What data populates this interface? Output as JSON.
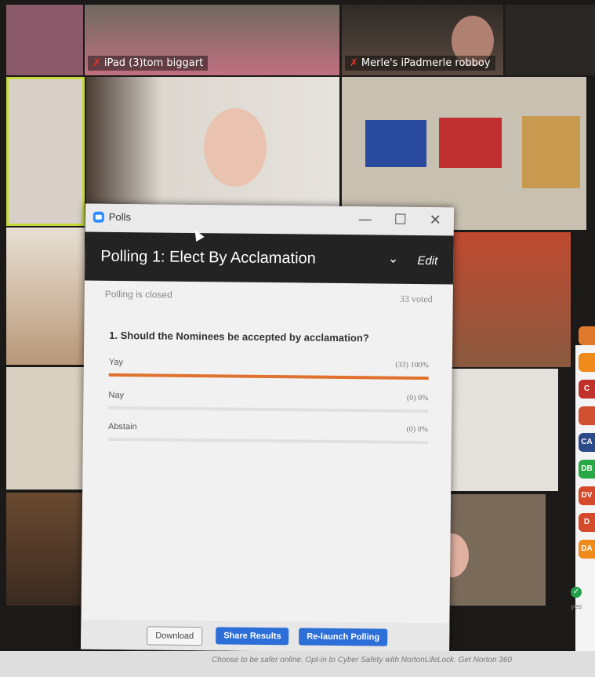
{
  "video_tiles": {
    "tile1_name": "iPad (3)tom biggart",
    "tile2_name": "Merle's iPadmerle robboy"
  },
  "participant_avatars": [
    {
      "initials": "",
      "color": "#e07a2a"
    },
    {
      "initials": "",
      "color": "#f08a1a"
    },
    {
      "initials": "C",
      "color": "#c0312b"
    },
    {
      "initials": "",
      "color": "#d05030"
    },
    {
      "initials": "CA",
      "color": "#2a4a8a"
    },
    {
      "initials": "DB",
      "color": "#28a745"
    },
    {
      "initials": "DV",
      "color": "#d44a2a"
    },
    {
      "initials": "D",
      "color": "#d44a2a"
    },
    {
      "initials": "DA",
      "color": "#f08a1a"
    }
  ],
  "yes_badge": {
    "label": "yes",
    "color": "#22a04a"
  },
  "polls_window": {
    "title": "Polls",
    "minimize": "—",
    "maximize": "☐",
    "close": "✕",
    "poll_title": "Polling 1: Elect By Acclamation",
    "edit_label": "Edit",
    "status": "Polling is closed",
    "voted": "33 voted",
    "question": "1. Should the Nominees be accepted by acclamation?",
    "answers": [
      {
        "label": "Yay",
        "result": "(33) 100%",
        "fraction": 1.0
      },
      {
        "label": "Nay",
        "result": "(0) 0%",
        "fraction": 0
      },
      {
        "label": "Abstain",
        "result": "(0) 0%",
        "fraction": 0
      }
    ],
    "buttons": {
      "download": "Download",
      "share": "Share Results",
      "relaunch": "Re-launch Polling"
    },
    "accent_color": "#e0722e"
  },
  "ticker_text": "Choose to be safer online. Opt-in to Cyber Safety with NortonLifeLock. Get Norton 360"
}
